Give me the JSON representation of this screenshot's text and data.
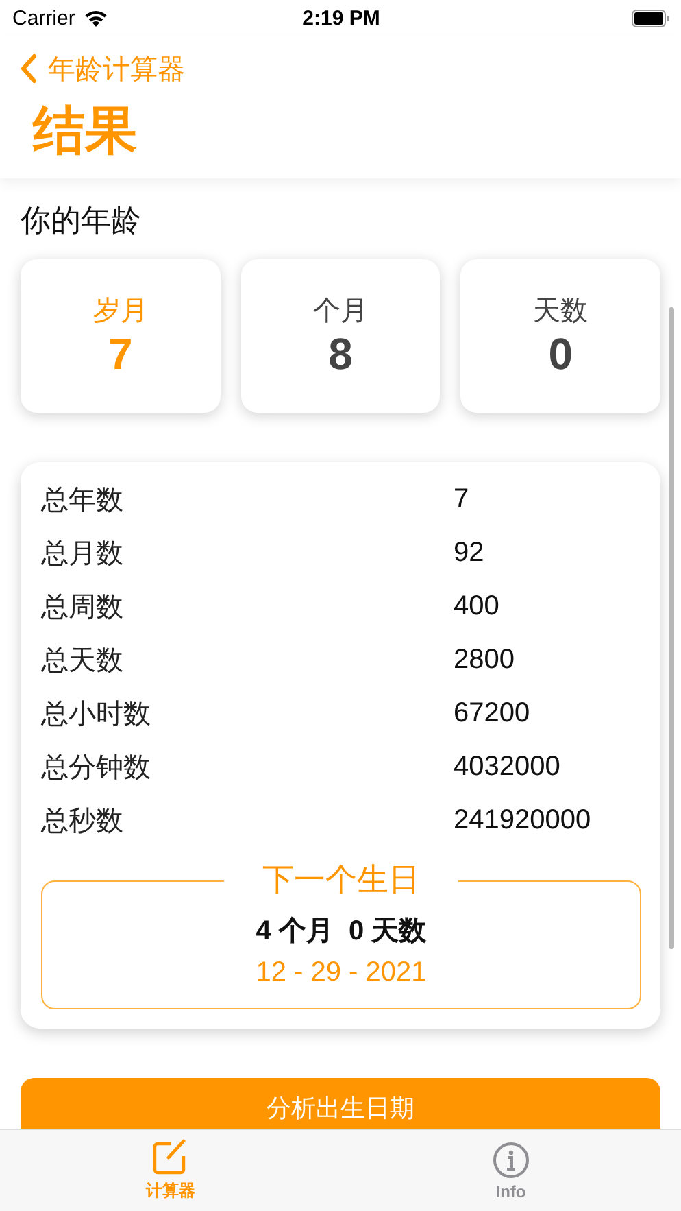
{
  "status_bar": {
    "carrier": "Carrier",
    "time": "2:19 PM"
  },
  "nav": {
    "back_label": "年龄计算器",
    "title": "结果"
  },
  "section_title": "你的年龄",
  "age_cards": [
    {
      "label": "岁月",
      "value": "7",
      "selected": true
    },
    {
      "label": "个月",
      "value": "8",
      "selected": false
    },
    {
      "label": "天数",
      "value": "0",
      "selected": false
    }
  ],
  "totals": [
    {
      "label": "总年数",
      "value": "7"
    },
    {
      "label": "总月数",
      "value": "92"
    },
    {
      "label": "总周数",
      "value": "400"
    },
    {
      "label": "总天数",
      "value": "2800"
    },
    {
      "label": "总小时数",
      "value": "67200"
    },
    {
      "label": "总分钟数",
      "value": "4032000"
    },
    {
      "label": "总秒数",
      "value": "241920000"
    }
  ],
  "next_birthday": {
    "title": "下一个生日",
    "countdown": "4 个月  0 天数",
    "date": "12 - 29 - 2021"
  },
  "action_button": "分析出生日期",
  "tabs": [
    {
      "label": "计算器",
      "kind": "edit",
      "selected": true
    },
    {
      "label": "Info",
      "kind": "info",
      "selected": false
    }
  ]
}
